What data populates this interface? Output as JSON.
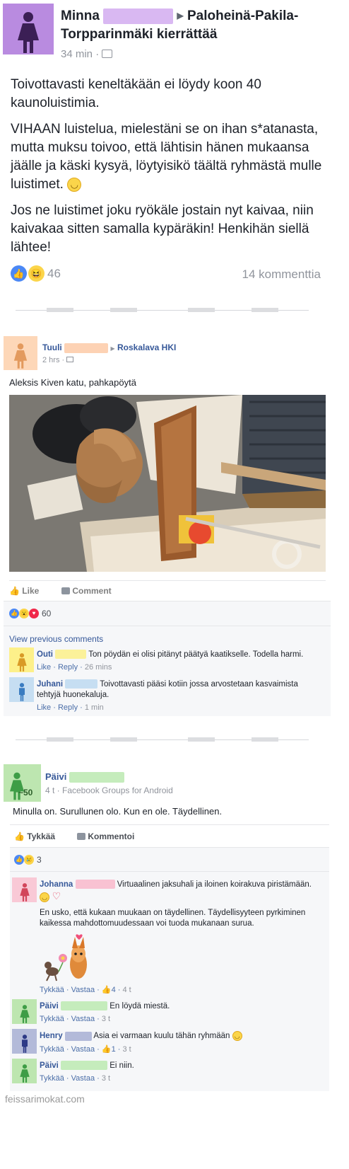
{
  "post1": {
    "author": "Minna",
    "group": "Paloheinä-Pakila-Torpparinmäki kierrättää",
    "time": "34 min",
    "paragraphs": [
      "Toivottavasti keneltäkään ei löydy koon 40 kaunoluistimia.",
      "VIHAAN luistelua, mielestäni se on ihan s*atanasta, mutta muksu toivoo, että lähtisin hänen mukaansa jäälle ja käski kysyä, löytyisikö täältä ryhmästä mulle luistimet.",
      "Jos ne luistimet joku ryökäle jostain nyt kaivaa, niin kaivakaa sitten samalla kypäräkin! Henkihän siellä lähtee!"
    ],
    "reactions_count": "46",
    "comments_count": "14 kommenttia",
    "colors": {
      "avatar_bg": "#b98be0",
      "name_blur": "#d9b8f2"
    }
  },
  "post2": {
    "author": "Tuuli",
    "group": "Roskalava HKI",
    "time": "2 hrs",
    "text": "Aleksis Kiven katu, pahkapöytä",
    "actions": {
      "like": "Like",
      "comment": "Comment"
    },
    "reactions_count": "60",
    "view_previous": "View previous comments",
    "comments": [
      {
        "name": "Outi",
        "text": "Ton pöydän ei olisi pitänyt päätyä kaatikselle. Todella harmi.",
        "like": "Like",
        "reply": "Reply",
        "time": "26 mins"
      },
      {
        "name": "Juhani",
        "text": "Toivottavasti pääsi kotiin jossa arvostetaan kasvaimista tehtyjä huonekaluja.",
        "like": "Like",
        "reply": "Reply",
        "time": "1 min"
      }
    ]
  },
  "post3": {
    "author": "Päivi",
    "badge": "~50",
    "time": "4 t · Facebook Groups for Android",
    "text": "Minulla on. Surullunen olo. Kun en ole. Täydellinen.",
    "actions": {
      "like": "Tykkää",
      "comment": "Kommentoi"
    },
    "reactions_count": "3",
    "comments": [
      {
        "name": "Johanna",
        "text": "Virtuaalinen jaksuhali ja iloinen koirakuva piristämään.",
        "text2": "En usko, että kukaan muukaan on täydellinen. Täydellisyyteen pyrkiminen kaikessa mahdottomuudessaan voi tuoda mukanaan surua.",
        "like": "Tykkää",
        "reply": "Vastaa",
        "likes": "4",
        "time": "4 t"
      },
      {
        "name": "Päivi",
        "text": "En löydä miestä.",
        "like": "Tykkää",
        "reply": "Vastaa",
        "time": "3 t"
      },
      {
        "name": "Henry",
        "text": "Asia ei varmaan kuulu tähän ryhmään",
        "like": "Tykkää",
        "reply": "Vastaa",
        "likes": "1",
        "time": "3 t"
      },
      {
        "name": "Päivi",
        "text": "Ei niin.",
        "like": "Tykkää",
        "reply": "Vastaa",
        "time": "3 t"
      }
    ]
  },
  "watermark": "feissarimokat.com"
}
